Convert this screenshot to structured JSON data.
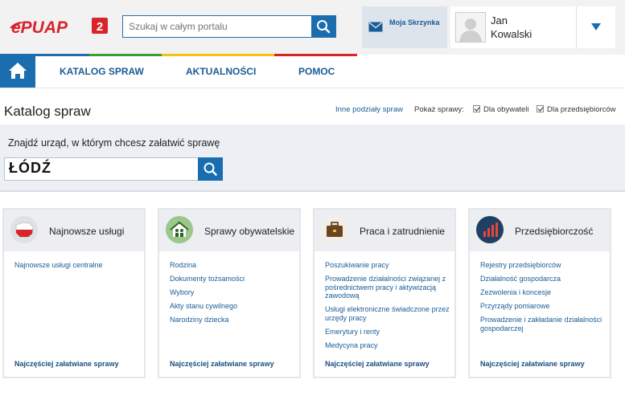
{
  "header": {
    "logo_text": "ePUAP",
    "logo_badge": "2",
    "search_placeholder": "Szukaj w całym portalu",
    "mailbox_label": "Moja Skrzynka",
    "user_first": "Jan",
    "user_last": "Kowalski"
  },
  "nav": {
    "items": [
      {
        "label": "KATALOG SPRAW"
      },
      {
        "label": "AKTUALNOŚCI"
      },
      {
        "label": "POMOC"
      }
    ]
  },
  "catalog": {
    "title": "Katalog spraw",
    "other_link": "Inne podziały spraw",
    "show_label": "Pokaż sprawy:",
    "filter_citizens": "Dla obywateli",
    "filter_business": "Dla przedsiębiorców",
    "filter_citizens_checked": true,
    "filter_business_checked": true
  },
  "find": {
    "label": "Znajdź urząd, w którym chcesz załatwić sprawę",
    "value": "ŁÓDŹ"
  },
  "cards": [
    {
      "title": "Najnowsze usługi",
      "icon": "poland-map-icon",
      "links": [
        "Najnowsze usługi centralne"
      ],
      "footer": "Najczęściej załatwiane sprawy"
    },
    {
      "title": "Sprawy obywatelskie",
      "icon": "family-house-icon",
      "links": [
        "Rodzina",
        "Dokumenty tożsamości",
        "Wybory",
        "Akty stanu cywilnego",
        "Narodziny dziecka"
      ],
      "footer": "Najczęściej załatwiane sprawy"
    },
    {
      "title": "Praca i zatrudnienie",
      "icon": "briefcase-icon",
      "links": [
        "Poszukiwanie pracy",
        "Prowadzenie działalności związanej z pośrednictwem pracy i aktywizacją zawodową",
        "Usługi elektroniczne świadczone przez urzędy pracy",
        "Emerytury i renty",
        "Medycyna pracy"
      ],
      "footer": "Najczęściej załatwiane sprawy"
    },
    {
      "title": "Przedsiębiorczość",
      "icon": "bar-chart-icon",
      "links": [
        "Rejestry przedsiębiorców",
        "Działalność gospodarcza",
        "Zezwolenia i koncesje",
        "Przyrządy pomiarowe",
        "Prowadzenie i zakładanie działalności gospodarczej"
      ],
      "footer": "Najczęściej załatwiane sprawy"
    }
  ],
  "colors": {
    "brand_blue": "#1a6eaf",
    "link_blue": "#1a5c96",
    "logo_red": "#d9232d"
  }
}
